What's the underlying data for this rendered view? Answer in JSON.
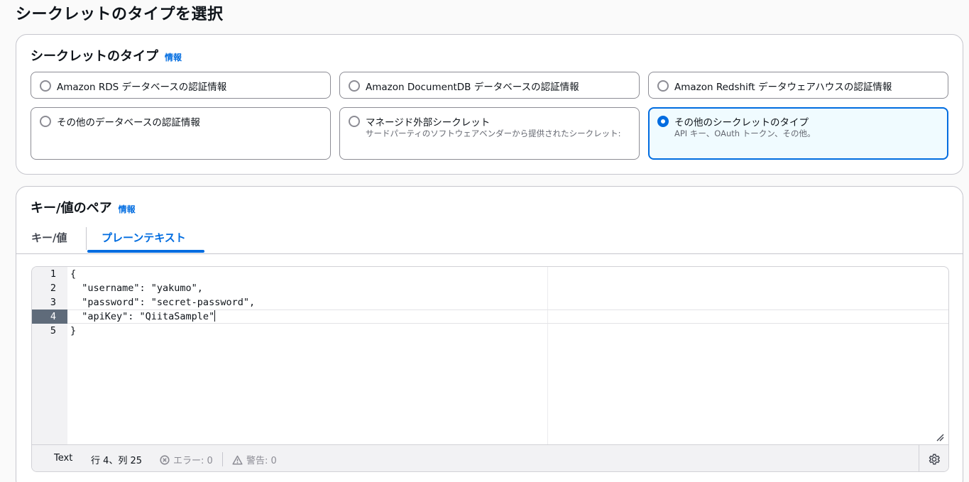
{
  "page": {
    "title": "シークレットのタイプを選択"
  },
  "secret_type": {
    "heading": "シークレットのタイプ",
    "info": "情報",
    "options": [
      {
        "label": "Amazon RDS データベースの認証情報",
        "description": "",
        "selected": false
      },
      {
        "label": "Amazon DocumentDB データベースの認証情報",
        "description": "",
        "selected": false
      },
      {
        "label": "Amazon Redshift データウェアハウスの認証情報",
        "description": "",
        "selected": false
      },
      {
        "label": "その他のデータベースの認証情報",
        "description": "",
        "selected": false
      },
      {
        "label": "マネージド外部シークレット",
        "description": "サードパーティのソフトウェアベンダーから提供されたシークレット:",
        "selected": false
      },
      {
        "label": "その他のシークレットのタイプ",
        "description": "API キー、OAuth トークン、その他。",
        "selected": true
      }
    ]
  },
  "kv": {
    "heading": "キー/値のペア",
    "info": "情報",
    "tabs": [
      {
        "label": "キー/値",
        "active": false
      },
      {
        "label": "プレーンテキスト",
        "active": true
      }
    ]
  },
  "editor": {
    "line_numbers": [
      "1",
      "2",
      "3",
      "4",
      "5"
    ],
    "lines": [
      "{",
      "  \"username\": \"yakumo\",",
      "  \"password\": \"secret-password\",",
      "  \"apiKey\": \"QiitaSample\"",
      "}"
    ],
    "active_line": 4,
    "status": {
      "mode": "Text",
      "position": "行 4、列 25",
      "errors": "エラー: 0",
      "warnings": "警告: 0"
    },
    "icons": {
      "errors": "error-circle-icon",
      "warnings": "warning-triangle-icon",
      "settings": "gear-icon",
      "resize": "resize-handle-icon"
    }
  },
  "colors": {
    "accent": "#006ce0",
    "selected_bg": "#f0fbff",
    "active_gutter": "#5f6b7a"
  }
}
